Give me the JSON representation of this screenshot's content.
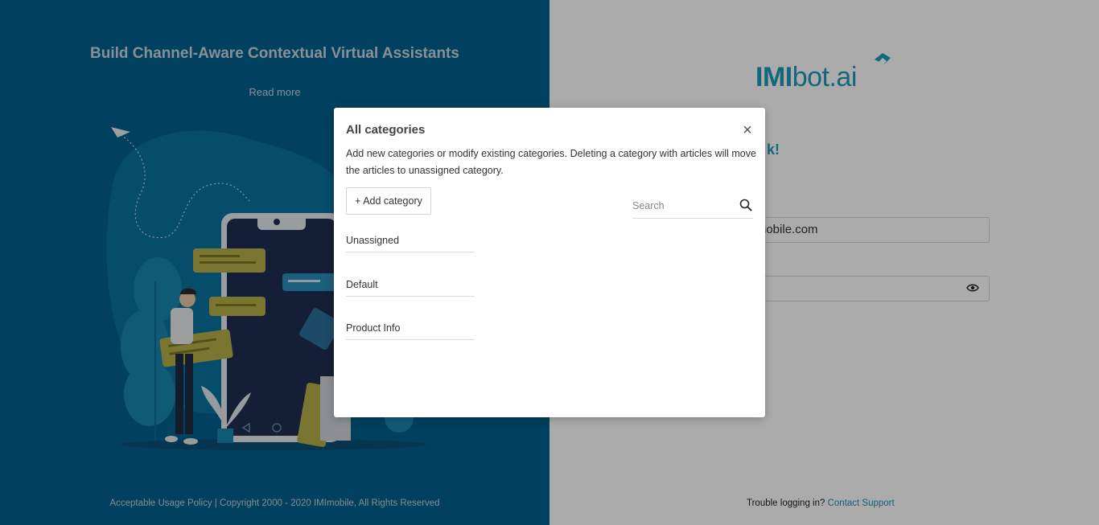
{
  "left": {
    "title": "Build Channel-Aware Contextual Virtual Assistants",
    "read_more": "Read more",
    "footer": "Acceptable Usage Policy | Copyright 2000 - 2020 IMImobile, All Rights Reserved"
  },
  "right": {
    "logo_bold": "IMI",
    "logo_rest": "bot.ai",
    "welcome_partial": "k!",
    "email_partial": "nobile.com",
    "footer_text": "Trouble logging in?",
    "footer_link": "Contact Support"
  },
  "modal": {
    "title": "All categories",
    "close_symbol": "×",
    "description": "Add new categories or modify existing categories. Deleting a category with articles will move the articles to unassigned category.",
    "add_button": "+ Add category",
    "search_placeholder": "Search",
    "categories": [
      "Unassigned",
      "Default",
      "Product Info"
    ]
  },
  "colors": {
    "left_bg": "#02608c",
    "accent": "#1c9bb6",
    "link": "#1c8fb4",
    "chat_bubble": "#b6b04a"
  },
  "icons": {
    "close": "close-icon",
    "search": "search-icon",
    "eye": "eye-icon",
    "logo_mark": "pen-nib-icon"
  }
}
